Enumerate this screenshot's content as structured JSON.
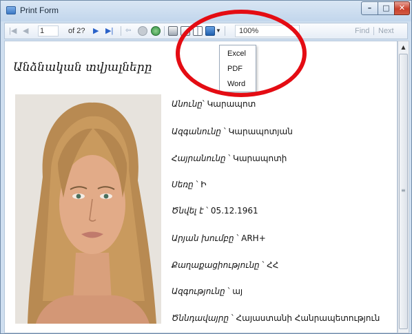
{
  "window": {
    "title": "Print Form",
    "controls": {
      "minimize": "–",
      "maximize": "□",
      "close": "✕"
    }
  },
  "toolbar": {
    "page_current": "1",
    "page_of": "of 2?",
    "zoom": "100%",
    "find": "Find",
    "next": "Next",
    "icons": [
      "first-page-icon",
      "prev-page-icon",
      "next-page-icon",
      "last-page-icon",
      "back-icon",
      "stop-icon",
      "refresh-icon",
      "print-icon",
      "print-layout-icon",
      "page-setup-icon",
      "export-icon"
    ]
  },
  "export_menu": {
    "items": [
      "Excel",
      "PDF",
      "Word"
    ]
  },
  "report": {
    "heading": "Անձնական տվյալները",
    "fields": [
      {
        "label": "Անունը",
        "value": "Կարապոտ"
      },
      {
        "label": "Ազգանունը",
        "value": "Կարապոտյան"
      },
      {
        "label": "Հայրանունը",
        "value": "Կարապոտի"
      },
      {
        "label": "Սեռը",
        "value": "Ի"
      },
      {
        "label": "Ծնվել է",
        "value": "05.12.1961"
      },
      {
        "label": "Արյան խումբը",
        "value": "ARH+"
      },
      {
        "label": "Քաղաքացիությունը",
        "value": "ՀՀ"
      },
      {
        "label": "Ազգությունը",
        "value": "այ"
      },
      {
        "label": "Ծննդավայրը",
        "value": "Հայաստանի Հանրապետություն"
      }
    ]
  },
  "colors": {
    "annotation_ring": "#e40c13",
    "nav_blue": "#2a62c9",
    "frame": "#cfdff0"
  }
}
